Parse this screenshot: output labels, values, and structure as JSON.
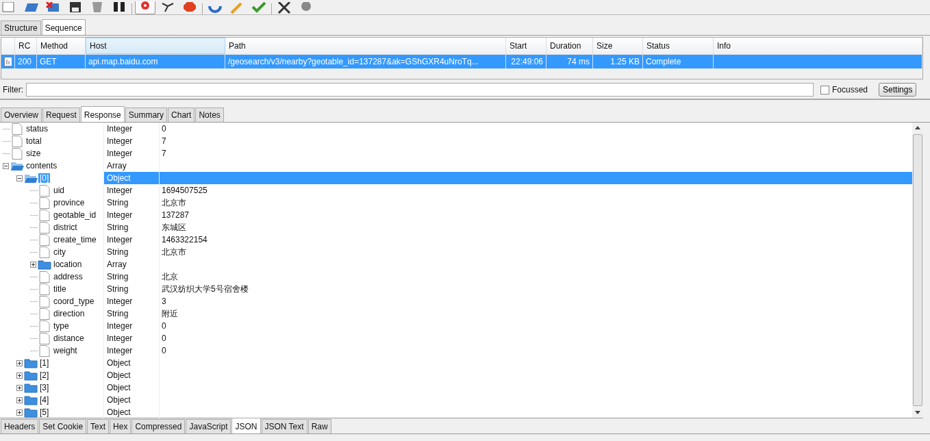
{
  "toolbar": {
    "recording": true
  },
  "view_tabs": [
    {
      "label": "Structure",
      "selected": false
    },
    {
      "label": "Sequence",
      "selected": true
    }
  ],
  "table": {
    "columns": [
      "RC",
      "Method",
      "Host",
      "Path",
      "Start",
      "Duration",
      "Size",
      "Status",
      "Info"
    ],
    "rows": [
      {
        "selected": true,
        "cells": [
          "200",
          "GET",
          "api.map.baidu.com",
          "/geosearch/v3/nearby?geotable_id=137287&ak=GShGXR4uNroTq...",
          "22:49:06",
          "74 ms",
          "1.25 KB",
          "Complete",
          ""
        ]
      }
    ]
  },
  "filter": {
    "label": "Filter:",
    "focussed": {
      "label": "Focussed",
      "checked": false
    },
    "settings": "Settings"
  },
  "detail_tabs": [
    {
      "label": "Overview",
      "selected": false
    },
    {
      "label": "Request",
      "selected": false
    },
    {
      "label": "Response",
      "selected": true
    },
    {
      "label": "Summary",
      "selected": false
    },
    {
      "label": "Chart",
      "selected": false
    },
    {
      "label": "Notes",
      "selected": false
    }
  ],
  "tree": [
    {
      "label": "status",
      "type": "Integer",
      "value": "0",
      "kind": "leaf",
      "selected": false
    },
    {
      "label": "total",
      "type": "Integer",
      "value": "7",
      "kind": "leaf",
      "selected": false
    },
    {
      "label": "size",
      "type": "Integer",
      "value": "7",
      "kind": "leaf",
      "selected": false
    },
    {
      "label": "contents",
      "type": "Array",
      "kind": "folder",
      "expanded": true,
      "selected": false,
      "children": [
        {
          "label": "[0]",
          "type": "Object",
          "kind": "folder",
          "expanded": true,
          "selected": true,
          "children": [
            {
              "label": "uid",
              "type": "Integer",
              "value": "1694507525",
              "kind": "leaf",
              "selected": false
            },
            {
              "label": "province",
              "type": "String",
              "value": "北京市",
              "kind": "leaf",
              "selected": false
            },
            {
              "label": "geotable_id",
              "type": "Integer",
              "value": "137287",
              "kind": "leaf",
              "selected": false
            },
            {
              "label": "district",
              "type": "String",
              "value": "东城区",
              "kind": "leaf",
              "selected": false
            },
            {
              "label": "create_time",
              "type": "Integer",
              "value": "1463322154",
              "kind": "leaf",
              "selected": false
            },
            {
              "label": "city",
              "type": "String",
              "value": "北京市",
              "kind": "leaf",
              "selected": false
            },
            {
              "label": "location",
              "type": "Array",
              "kind": "folder",
              "expanded": false,
              "selected": false
            },
            {
              "label": "address",
              "type": "String",
              "value": "北京",
              "kind": "leaf",
              "selected": false
            },
            {
              "label": "title",
              "type": "String",
              "value": "武汉纺织大学5号宿舍楼",
              "kind": "leaf",
              "selected": false
            },
            {
              "label": "coord_type",
              "type": "Integer",
              "value": "3",
              "kind": "leaf",
              "selected": false
            },
            {
              "label": "direction",
              "type": "String",
              "value": "附近",
              "kind": "leaf",
              "selected": false
            },
            {
              "label": "type",
              "type": "Integer",
              "value": "0",
              "kind": "leaf",
              "selected": false
            },
            {
              "label": "distance",
              "type": "Integer",
              "value": "0",
              "kind": "leaf",
              "selected": false
            },
            {
              "label": "weight",
              "type": "Integer",
              "value": "0",
              "kind": "leaf",
              "selected": false
            }
          ]
        },
        {
          "label": "[1]",
          "type": "Object",
          "kind": "folder",
          "expanded": false,
          "selected": false
        },
        {
          "label": "[2]",
          "type": "Object",
          "kind": "folder",
          "expanded": false,
          "selected": false
        },
        {
          "label": "[3]",
          "type": "Object",
          "kind": "folder",
          "expanded": false,
          "selected": false
        },
        {
          "label": "[4]",
          "type": "Object",
          "kind": "folder",
          "expanded": false,
          "selected": false
        },
        {
          "label": "[5]",
          "type": "Object",
          "kind": "folder",
          "expanded": false,
          "selected": false
        }
      ]
    }
  ],
  "format_tabs": [
    {
      "label": "Headers",
      "selected": false
    },
    {
      "label": "Set Cookie",
      "selected": false
    },
    {
      "label": "Text",
      "selected": false
    },
    {
      "label": "Hex",
      "selected": false
    },
    {
      "label": "Compressed",
      "selected": false
    },
    {
      "label": "JavaScript",
      "selected": false
    },
    {
      "label": "JSON",
      "selected": true
    },
    {
      "label": "JSON Text",
      "selected": false
    },
    {
      "label": "Raw",
      "selected": false
    }
  ]
}
